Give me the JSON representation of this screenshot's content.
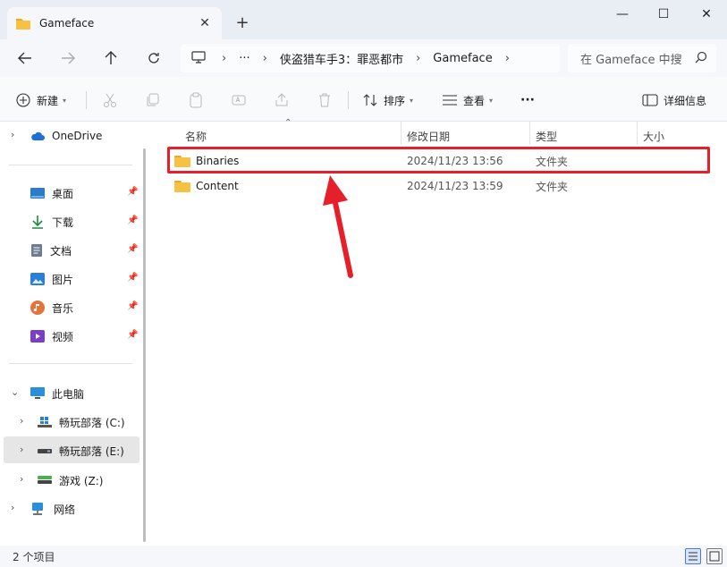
{
  "window": {
    "tab_title": "Gameface",
    "tab_close": "✕",
    "new_tab": "+",
    "minimize": "—",
    "maximize": "☐",
    "close": "✕"
  },
  "address": {
    "more": "···",
    "sep": "›",
    "crumbs": [
      "侠盗猎车手3：罪恶都市",
      "Gameface"
    ],
    "search_placeholder": "在 Gameface 中搜"
  },
  "toolbar": {
    "new_label": "新建",
    "sort_label": "排序",
    "view_label": "查看",
    "more": "···",
    "details_label": "详细信息"
  },
  "sidebar": {
    "items": [
      {
        "label": "OneDrive"
      },
      {
        "label": "桌面"
      },
      {
        "label": "下载"
      },
      {
        "label": "文档"
      },
      {
        "label": "图片"
      },
      {
        "label": "音乐"
      },
      {
        "label": "视频"
      },
      {
        "label": "此电脑"
      },
      {
        "label": "畅玩部落 (C:)"
      },
      {
        "label": "畅玩部落 (E:)"
      },
      {
        "label": "游戏 (Z:)"
      },
      {
        "label": "网络"
      }
    ]
  },
  "files": {
    "columns": [
      "名称",
      "修改日期",
      "类型",
      "大小"
    ],
    "rows": [
      {
        "name": "Binaries",
        "date": "2024/11/23 13:56",
        "type": "文件夹"
      },
      {
        "name": "Content",
        "date": "2024/11/23 13:59",
        "type": "文件夹"
      }
    ]
  },
  "status": {
    "count": "2 个项目"
  },
  "colors": {
    "highlight": "#e5202b",
    "folder": "#f6c244"
  }
}
